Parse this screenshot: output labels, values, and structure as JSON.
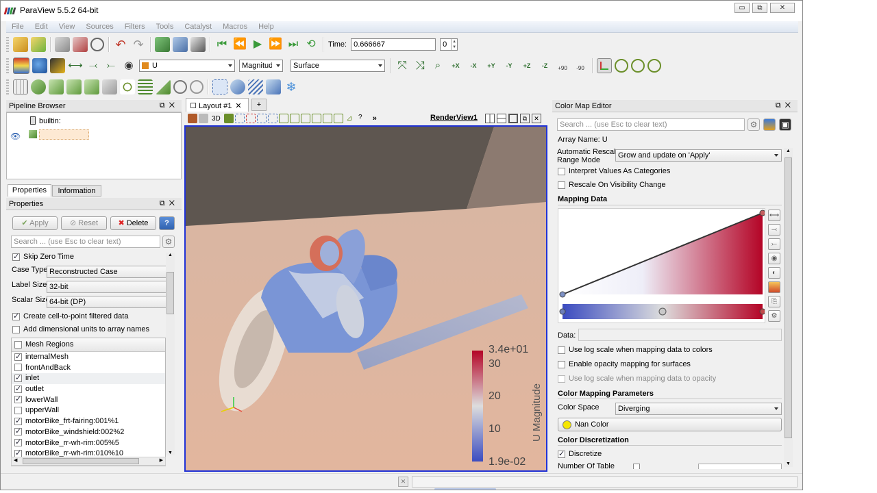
{
  "window": {
    "title": "ParaView 5.5.2 64-bit",
    "minimize_glyph": "▭",
    "maximize_glyph": "⧉",
    "close_glyph": "✕"
  },
  "menu": [
    "File",
    "Edit",
    "View",
    "Sources",
    "Filters",
    "Tools",
    "Catalyst",
    "Macros",
    "Help"
  ],
  "toolbar": {
    "time_label": "Time:",
    "time_value": "0.666667",
    "timestep_value": "0",
    "array_value": "U",
    "component_value": "Magnitude",
    "representation_value": "Surface",
    "view_labels": [
      "+X",
      "-X",
      "+Y",
      "-Y",
      "+Z",
      "-Z"
    ],
    "rotate_labels": [
      "+90",
      "-90"
    ]
  },
  "pipeline": {
    "title": "Pipeline Browser",
    "root": "builtin:",
    "float_glyph": "⧉",
    "close_glyph": "✕"
  },
  "tabs": {
    "properties": "Properties",
    "information": "Information"
  },
  "properties": {
    "title": "Properties",
    "apply": "Apply",
    "reset": "Reset",
    "delete": "Delete",
    "help": "?",
    "search_placeholder": "Search ... (use Esc to clear text)",
    "skip_zero_time": "Skip Zero Time",
    "case_type_label": "Case Type",
    "case_type_value": "Reconstructed Case",
    "label_size_label": "Label Size",
    "label_size_value": "32-bit",
    "scalar_size_label": "Scalar Size",
    "scalar_size_value": "64-bit (DP)",
    "create_cell_to_point": "Create cell-to-point filtered data",
    "add_dim_units": "Add dimensional units to array names",
    "mesh_regions_header": "Mesh Regions",
    "regions": [
      {
        "name": "internalMesh",
        "checked": true
      },
      {
        "name": "frontAndBack",
        "checked": false
      },
      {
        "name": "inlet",
        "checked": true
      },
      {
        "name": "outlet",
        "checked": true
      },
      {
        "name": "lowerWall",
        "checked": true
      },
      {
        "name": "upperWall",
        "checked": false
      },
      {
        "name": "motorBike_frt-fairing:001%1",
        "checked": true
      },
      {
        "name": "motorBike_windshield:002%2",
        "checked": true
      },
      {
        "name": "motorBike_rr-wh-rim:005%5",
        "checked": true
      },
      {
        "name": "motorBike_rr-wh-rim:010%10",
        "checked": true
      }
    ]
  },
  "layout": {
    "tab_label": "Layout #1",
    "tab_close": "✕",
    "add_tab": "+",
    "view_name": "RenderView1",
    "mode_3d": "3D",
    "more": "»"
  },
  "legend": {
    "title": "U Magnitude",
    "max_label": "3.4e+01",
    "min_label": "1.9e-02",
    "ticks": [
      "30",
      "20",
      "10"
    ],
    "min_color": "#3b4cc0",
    "max_color": "#b40426"
  },
  "color_map_editor": {
    "title": "Color Map Editor",
    "search_placeholder": "Search ... (use Esc to clear text)",
    "array_name": "Array Name: U",
    "auto_rescale_label_1": "Automatic Rescale",
    "auto_rescale_label_2": "Range Mode",
    "auto_rescale_value": "Grow and update on 'Apply'",
    "interpret_categories": "Interpret Values As Categories",
    "rescale_visibility": "Rescale On Visibility Change",
    "mapping_data_header": "Mapping Data",
    "data_label": "Data:",
    "log_scale_colors": "Use log scale when mapping data to colors",
    "opacity_mapping": "Enable opacity mapping for surfaces",
    "log_scale_opacity": "Use log scale when mapping data to opacity",
    "color_mapping_params_header": "Color Mapping Parameters",
    "color_space_label": "Color Space",
    "color_space_value": "Diverging",
    "nan_color_label": "Nan Color",
    "nan_color": "#f5e600",
    "color_discretization_header": "Color Discretization",
    "discretize": "Discretize",
    "number_of_table_values": "Number Of Table"
  },
  "statusbar": {
    "close_glyph": "✕"
  }
}
